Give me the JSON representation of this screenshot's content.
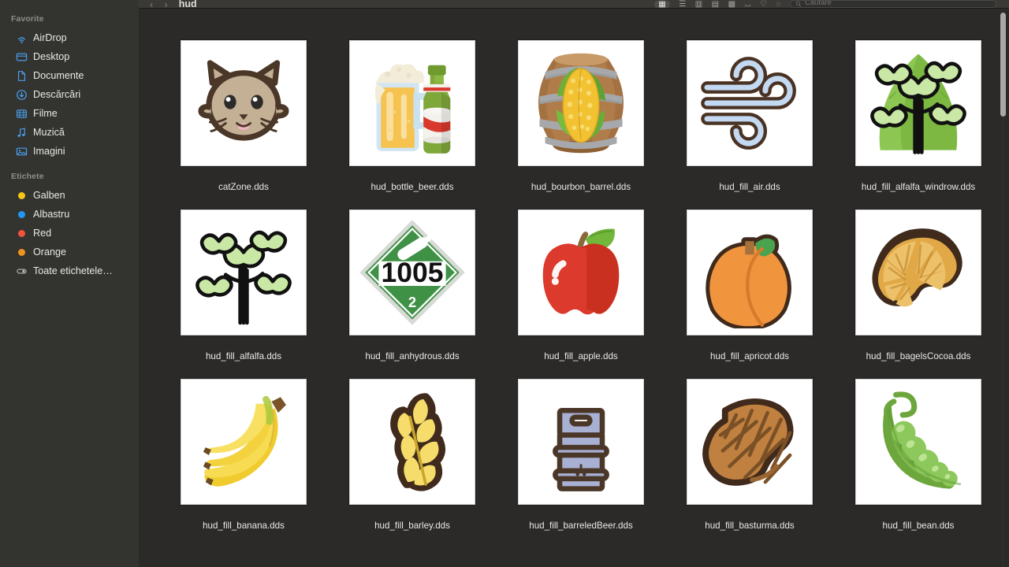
{
  "sidebar": {
    "sections": [
      {
        "title": "Favorite",
        "items": [
          {
            "label": "AirDrop",
            "icon": "airdrop-icon"
          },
          {
            "label": "Desktop",
            "icon": "desktop-icon"
          },
          {
            "label": "Documente",
            "icon": "document-icon"
          },
          {
            "label": "Descărcări",
            "icon": "downloads-icon"
          },
          {
            "label": "Filme",
            "icon": "movies-icon"
          },
          {
            "label": "Muzică",
            "icon": "music-icon"
          },
          {
            "label": "Imagini",
            "icon": "pictures-icon"
          }
        ]
      },
      {
        "title": "Etichete",
        "items": [
          {
            "label": "Galben",
            "icon": "tag-dot-icon",
            "color": "#f5c518"
          },
          {
            "label": "Albastru",
            "icon": "tag-dot-icon",
            "color": "#2196f3"
          },
          {
            "label": "Red",
            "icon": "tag-dot-icon",
            "color": "#f4533b"
          },
          {
            "label": "Orange",
            "icon": "tag-dot-icon",
            "color": "#f0921e"
          },
          {
            "label": "Toate etichetele…",
            "icon": "all-tags-icon"
          }
        ]
      }
    ]
  },
  "toolbar": {
    "back_label": "‹",
    "forward_label": "›",
    "title": "hud",
    "view_icon_grid": "▦",
    "view_icon_list": "☰",
    "view_icon_column": "▥",
    "view_icon_gallery": "▤",
    "group_label": "▩",
    "share_label": "⌴",
    "tag_label": "♡",
    "more_label": "◌",
    "search_icon": "search-icon",
    "search_placeholder": "Căutare",
    "search_value": ""
  },
  "files": [
    {
      "name": "catZone.dds",
      "icon": "cat-face"
    },
    {
      "name": "hud_bottle_beer.dds",
      "icon": "bottle-beer"
    },
    {
      "name": "hud_bourbon_barrel.dds",
      "icon": "bourbon-barrel"
    },
    {
      "name": "hud_fill_air.dds",
      "icon": "wind"
    },
    {
      "name": "hud_fill_alfalfa_windrow.dds",
      "icon": "alfalfa-windrow"
    },
    {
      "name": "hud_fill_alfalfa.dds",
      "icon": "alfalfa"
    },
    {
      "name": "hud_fill_anhydrous.dds",
      "icon": "hazmat-1005"
    },
    {
      "name": "hud_fill_apple.dds",
      "icon": "apple"
    },
    {
      "name": "hud_fill_apricot.dds",
      "icon": "apricot"
    },
    {
      "name": "hud_fill_bagelsCocoa.dds",
      "icon": "croissant"
    },
    {
      "name": "hud_fill_banana.dds",
      "icon": "banana"
    },
    {
      "name": "hud_fill_barley.dds",
      "icon": "barley"
    },
    {
      "name": "hud_fill_barreledBeer.dds",
      "icon": "keg"
    },
    {
      "name": "hud_fill_basturma.dds",
      "icon": "basturma"
    },
    {
      "name": "hud_fill_bean.dds",
      "icon": "pea-pod"
    }
  ],
  "hazmat": {
    "number": "1005",
    "class": "2"
  },
  "colors": {
    "window_bg": "#2b2a28",
    "sidebar_bg": "#333330",
    "accent_blue": "#3f8fe0",
    "text": "#e9e9e6",
    "muted_text": "#8d8d88"
  }
}
